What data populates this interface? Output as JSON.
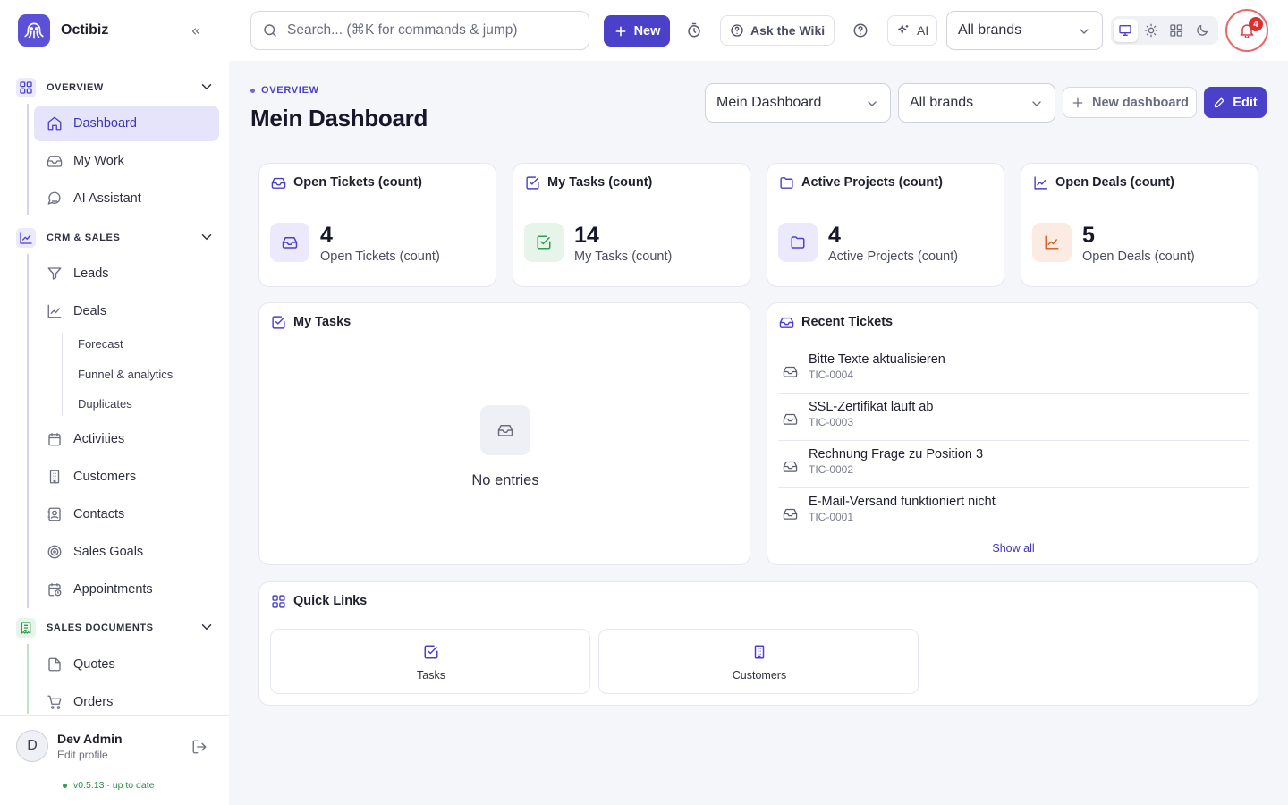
{
  "app": {
    "name": "Octibiz"
  },
  "sidebar": {
    "sections": [
      {
        "label": "OVERVIEW"
      },
      {
        "label": "CRM & SALES"
      },
      {
        "label": "SALES DOCUMENTS"
      }
    ],
    "overview_items": [
      {
        "label": "Dashboard",
        "icon": "home-icon",
        "active": true
      },
      {
        "label": "My Work",
        "icon": "inbox-icon"
      },
      {
        "label": "AI Assistant",
        "icon": "chat-icon"
      }
    ],
    "crm_items": [
      {
        "label": "Leads",
        "icon": "filter-icon"
      },
      {
        "label": "Deals",
        "icon": "trending-icon"
      }
    ],
    "deal_sub_items": [
      {
        "label": "Forecast"
      },
      {
        "label": "Funnel & analytics"
      },
      {
        "label": "Duplicates"
      }
    ],
    "crm_items_after": [
      {
        "label": "Activities",
        "icon": "calendar-icon"
      },
      {
        "label": "Customers",
        "icon": "building-icon"
      },
      {
        "label": "Contacts",
        "icon": "contact-icon"
      },
      {
        "label": "Sales Goals",
        "icon": "target-icon"
      },
      {
        "label": "Appointments",
        "icon": "calendar-clock-icon"
      }
    ],
    "doc_items": [
      {
        "label": "Quotes",
        "icon": "file-icon"
      },
      {
        "label": "Orders",
        "icon": "cart-icon"
      }
    ]
  },
  "user": {
    "initial": "D",
    "name": "Dev Admin",
    "edit_label": "Edit profile",
    "version": "v0.5.13 · up to date"
  },
  "topbar": {
    "search_placeholder": "Search... (⌘K for commands & jump)",
    "new_label": "New",
    "wiki_label": "Ask the Wiki",
    "ai_label": "AI",
    "brand_select": "All brands",
    "notification_count": "4"
  },
  "header": {
    "eyebrow": "OVERVIEW",
    "title": "Mein Dashboard",
    "dashboard_select": "Mein Dashboard",
    "brand_select": "All brands",
    "new_dashboard_label": "New dashboard",
    "edit_label": "Edit"
  },
  "stats": [
    {
      "title": "Open Tickets (count)",
      "value": "4",
      "label": "Open Tickets (count)",
      "icon": "inbox-icon",
      "color": "#4a40c9",
      "bg": "#ebe9fb"
    },
    {
      "title": "My Tasks (count)",
      "value": "14",
      "label": "My Tasks (count)",
      "icon": "check-square-icon",
      "color": "#2f9e4f",
      "bg": "#e6f4ea"
    },
    {
      "title": "Active Projects (count)",
      "value": "4",
      "label": "Active Projects (count)",
      "icon": "folder-icon",
      "color": "#4a40c9",
      "bg": "#ebe9fb"
    },
    {
      "title": "Open Deals (count)",
      "value": "5",
      "label": "Open Deals (count)",
      "icon": "trending-icon",
      "color": "#d9622b",
      "bg": "#fcebe2"
    }
  ],
  "my_tasks": {
    "title": "My Tasks",
    "empty_text": "No entries"
  },
  "recent_tickets": {
    "title": "Recent Tickets",
    "items": [
      {
        "title": "Bitte Texte aktualisieren",
        "id": "TIC-0004"
      },
      {
        "title": "SSL-Zertifikat läuft ab",
        "id": "TIC-0003"
      },
      {
        "title": "Rechnung Frage zu Position 3",
        "id": "TIC-0002"
      },
      {
        "title": "E-Mail-Versand funktioniert nicht",
        "id": "TIC-0001"
      }
    ],
    "show_all": "Show all"
  },
  "quick_links": {
    "title": "Quick Links",
    "items": [
      {
        "label": "Tasks",
        "icon": "check-square-icon"
      },
      {
        "label": "Customers",
        "icon": "building-icon"
      }
    ]
  }
}
